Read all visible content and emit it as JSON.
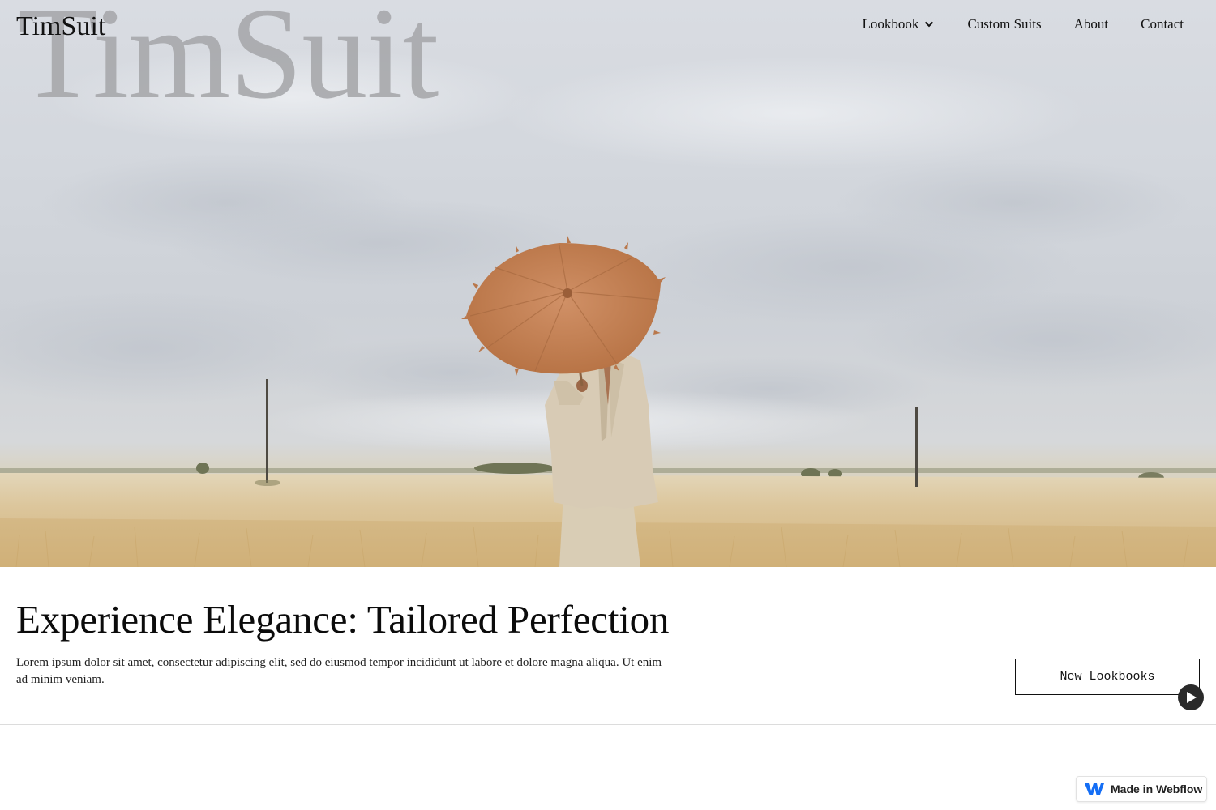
{
  "brand": {
    "watermark": "TimSuit",
    "logo": "TimSuit"
  },
  "nav": {
    "items": [
      {
        "label": "Lookbook",
        "has_dropdown": true,
        "icon": "chevron-down-icon"
      },
      {
        "label": "Custom Suits"
      },
      {
        "label": "About"
      },
      {
        "label": "Contact"
      }
    ]
  },
  "hero": {
    "image": "woman-with-umbrella-in-wheat-field",
    "colors": {
      "sky": "#d3d7dd",
      "field": "#d9c49a",
      "umbrella": "#c8875a",
      "suit": "#d8cbb5"
    }
  },
  "main": {
    "headline": "Experience Elegance: Tailored Perfection",
    "body": "Lorem ipsum dolor sit amet, consectetur adipiscing elit, sed do eiusmod tempor incididunt ut labore et dolore magna aliqua. Ut enim ad minim veniam.",
    "cta_label": "New Lookbooks"
  },
  "floating": {
    "play_icon": "play-icon"
  },
  "webflow_badge": {
    "label": "Made in Webflow",
    "icon": "webflow-logo-icon"
  }
}
